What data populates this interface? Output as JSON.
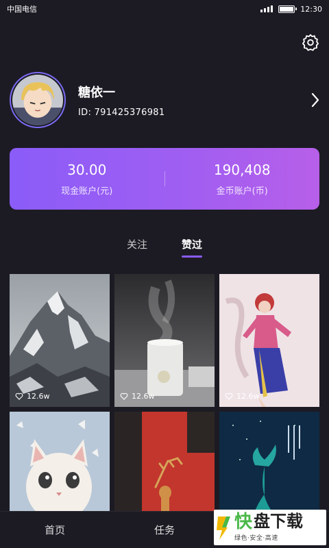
{
  "status_bar": {
    "carrier": "中国电信",
    "time": "12:30"
  },
  "profile": {
    "nickname": "糖依一",
    "id_text": "ID: 791425376981"
  },
  "wallet": {
    "cash": {
      "value": "30.00",
      "label": "现金账户(元)"
    },
    "coins": {
      "value": "190,408",
      "label": "金币账户(币)"
    }
  },
  "tabs": [
    {
      "label": "关注",
      "active": false
    },
    {
      "label": "赞过",
      "active": true
    }
  ],
  "grid": {
    "items": [
      {
        "subject": "snowy mountain",
        "likes": "12.6w"
      },
      {
        "subject": "humidifier",
        "likes": "12.6w"
      },
      {
        "subject": "dancer",
        "likes": "12.6w"
      },
      {
        "subject": "cat",
        "likes": ""
      },
      {
        "subject": "deer",
        "likes": ""
      },
      {
        "subject": "whale",
        "likes": ""
      }
    ]
  },
  "bottom_nav": {
    "items": [
      {
        "label": "首页"
      },
      {
        "label": "任务"
      },
      {
        "label": ""
      }
    ]
  },
  "watermark": {
    "title_1": "快",
    "title_2": "盘下载",
    "subtitle": "绿色·安全·高速"
  },
  "colors": {
    "background": "#1c1b24",
    "accent": "#8b5cf8",
    "wallet_gradient_end": "#b75fe9"
  }
}
